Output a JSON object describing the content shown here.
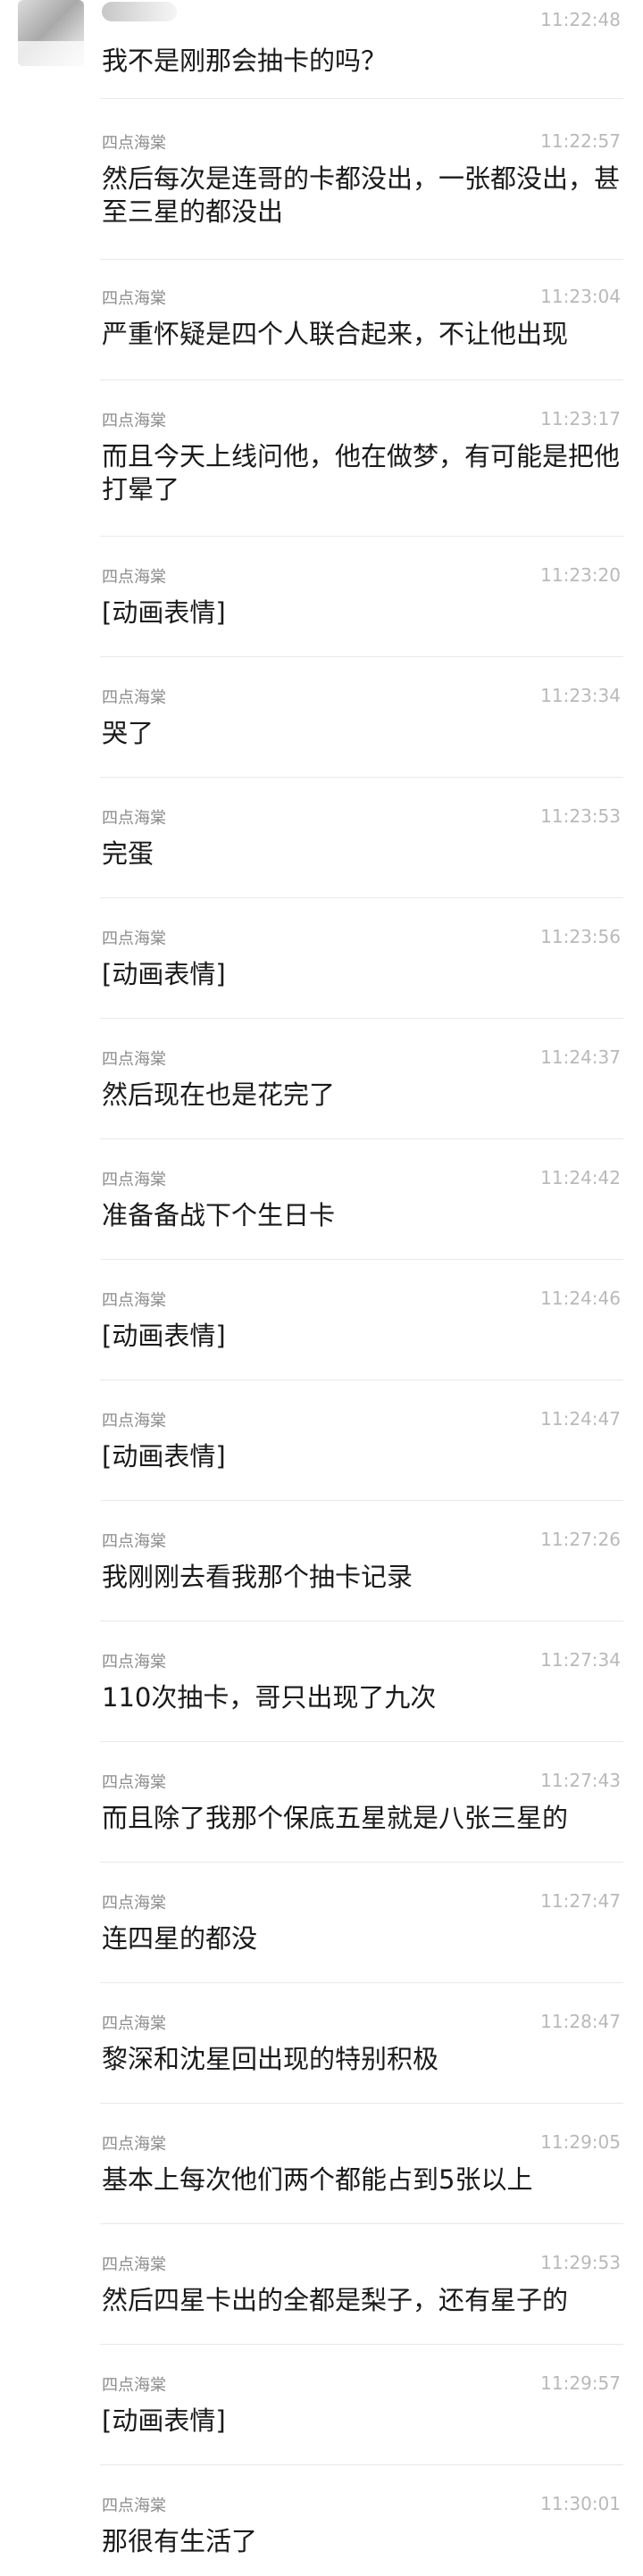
{
  "messages": [
    {
      "sender": "",
      "time": "11:22:48",
      "text": "我不是刚那会抽卡的吗？"
    },
    {
      "sender": "四点海棠",
      "time": "11:22:57",
      "text": "然后每次是连哥的卡都没出，一张都没出，甚至三星的都没出"
    },
    {
      "sender": "四点海棠",
      "time": "11:23:04",
      "text": "严重怀疑是四个人联合起来，不让他出现"
    },
    {
      "sender": "四点海棠",
      "time": "11:23:17",
      "text": "而且今天上线问他，他在做梦，有可能是把他打晕了"
    },
    {
      "sender": "四点海棠",
      "time": "11:23:20",
      "text": "[动画表情]"
    },
    {
      "sender": "四点海棠",
      "time": "11:23:34",
      "text": "哭了"
    },
    {
      "sender": "四点海棠",
      "time": "11:23:53",
      "text": "完蛋"
    },
    {
      "sender": "四点海棠",
      "time": "11:23:56",
      "text": "[动画表情]"
    },
    {
      "sender": "四点海棠",
      "time": "11:24:37",
      "text": "然后现在也是花完了"
    },
    {
      "sender": "四点海棠",
      "time": "11:24:42",
      "text": "准备备战下个生日卡"
    },
    {
      "sender": "四点海棠",
      "time": "11:24:46",
      "text": "[动画表情]"
    },
    {
      "sender": "四点海棠",
      "time": "11:24:47",
      "text": "[动画表情]"
    },
    {
      "sender": "四点海棠",
      "time": "11:27:26",
      "text": "我刚刚去看我那个抽卡记录"
    },
    {
      "sender": "四点海棠",
      "time": "11:27:34",
      "text": "110次抽卡，哥只出现了九次"
    },
    {
      "sender": "四点海棠",
      "time": "11:27:43",
      "text": "而且除了我那个保底五星就是八张三星的"
    },
    {
      "sender": "四点海棠",
      "time": "11:27:47",
      "text": "连四星的都没"
    },
    {
      "sender": "四点海棠",
      "time": "11:28:47",
      "text": "黎深和沈星回出现的特别积极"
    },
    {
      "sender": "四点海棠",
      "time": "11:29:05",
      "text": "基本上每次他们两个都能占到5张以上"
    },
    {
      "sender": "四点海棠",
      "time": "11:29:53",
      "text": "然后四星卡出的全都是梨子，还有星子的"
    },
    {
      "sender": "四点海棠",
      "time": "11:29:57",
      "text": "[动画表情]"
    },
    {
      "sender": "四点海棠",
      "time": "11:30:01",
      "text": "那很有生活了"
    }
  ]
}
